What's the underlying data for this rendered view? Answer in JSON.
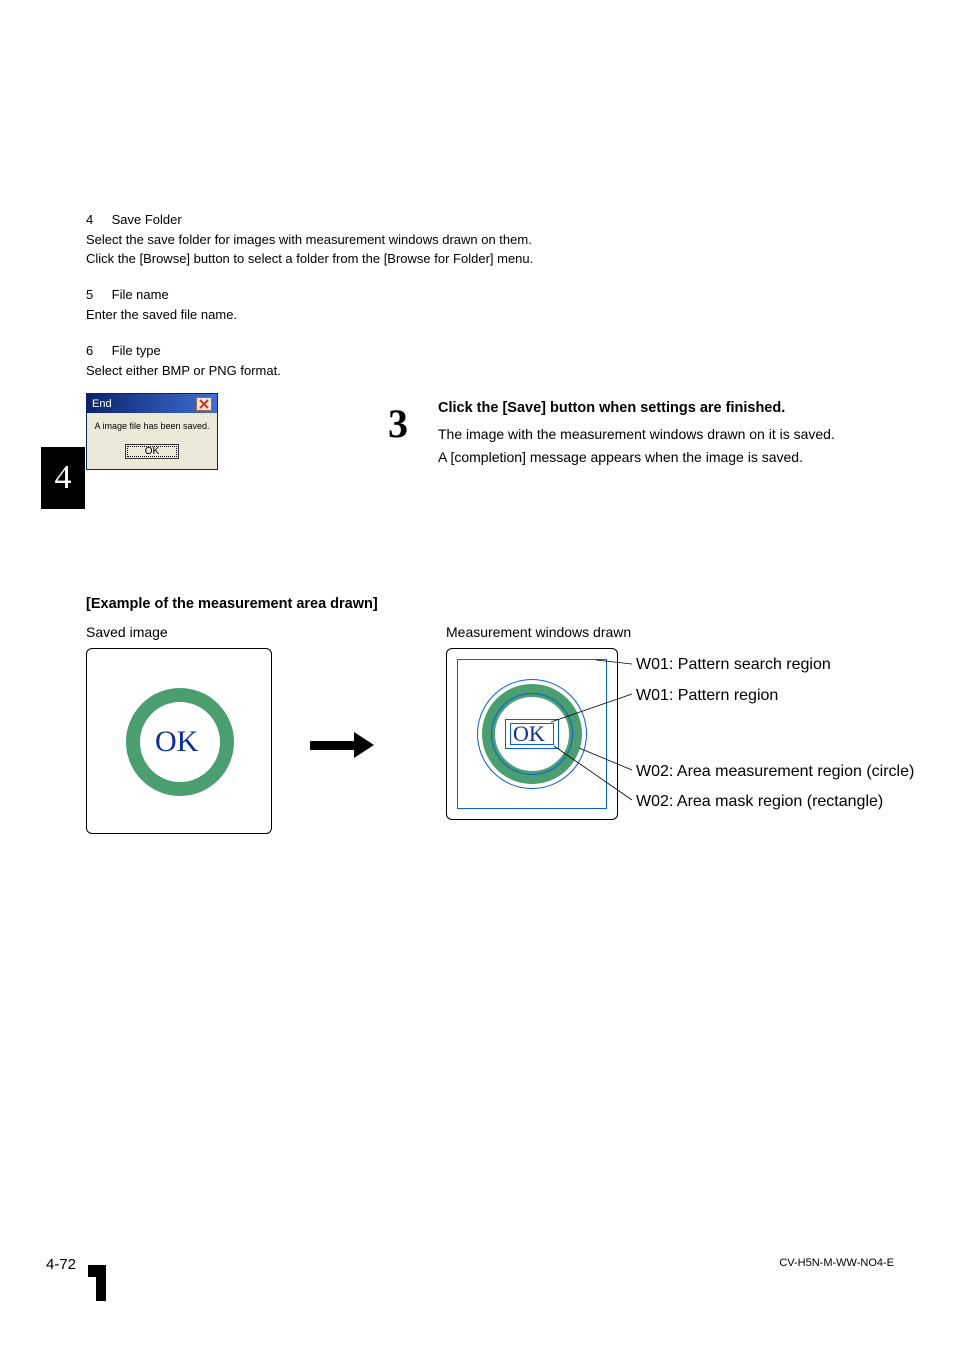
{
  "chapterTabNumber": "4",
  "sections": {
    "s4": {
      "num": "4",
      "title": "Save Folder",
      "line1": "Select the save folder for images with measurement windows drawn on them.",
      "line2": "Click the [Browse] button to select a folder from the [Browse for Folder] menu."
    },
    "s5": {
      "num": "5",
      "title": "File name",
      "line1": "Enter the saved file name."
    },
    "s6": {
      "num": "6",
      "title": "File type",
      "line1": "Select either BMP or PNG format."
    }
  },
  "dialog": {
    "title": "End",
    "message": "A image file has been saved.",
    "okLabel": "OK"
  },
  "step3": {
    "num": "3",
    "heading": "Click the [Save] button when settings are finished.",
    "line1": "The image with the measurement windows drawn on it is saved.",
    "line2": "A [completion] message appears when the image is saved."
  },
  "example": {
    "title": "[Example of the measurement area drawn]",
    "leftLabel": "Saved image",
    "rightLabel": "Measurement windows drawn",
    "okText": "OK",
    "annotations": {
      "a1": "W01: Pattern search region",
      "a2": "W01: Pattern region",
      "a3": "W02: Area measurement region (circle)",
      "a4": "W02: Area mask region (rectangle)"
    }
  },
  "footer": {
    "pageNum": "4-72",
    "docCode": "CV-H5N-M-WW-NO4-E"
  }
}
